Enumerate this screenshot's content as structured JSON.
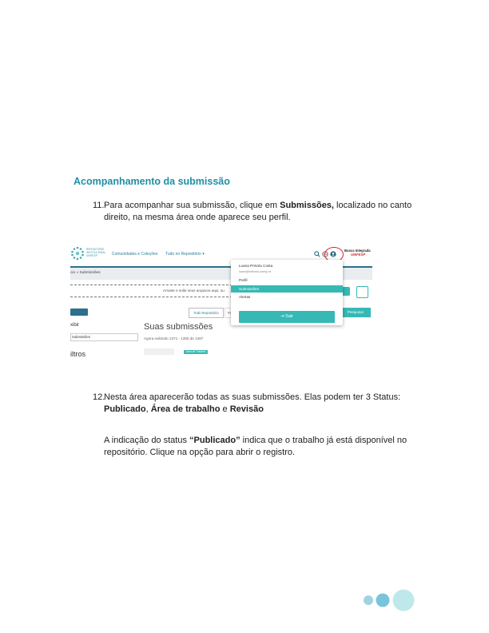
{
  "section_title": "Acompanhamento da submissão",
  "step11": {
    "number": "11.",
    "text_before": "Para acompanhar sua submissão, clique em ",
    "bold": "Submissões,",
    "text_after": " localizado no canto direito, na mesma área onde aparece seu perfil."
  },
  "screenshot": {
    "logo_text": "REPOSITÓRIO INSTITUCIONAL UNIFESP",
    "nav_communities": "Comunidades e Coleções",
    "nav_repository": "Tudo no Repositório ▾",
    "busca_line1": "Busca Integrada",
    "busca_line2": "UNIFESP",
    "breadcrumb": "cio » Submissões",
    "upload_text": "Arraste e solte seus arquivos aqui, ou",
    "tab_all": "Todo Repositório",
    "search_placeholder": "Pesquisar no repositório",
    "search_button": "Pesquisar",
    "exibir_label": "xibir",
    "select_value": "Submissões",
    "filtros_label": "iltros",
    "page_title": "Suas submissões",
    "showing": "Agora exibindo 1371 - 1380 de 1387",
    "badge": "Área de Trabalho",
    "menu": {
      "user_name": "Luana Priscila Costa",
      "user_email": "luana@reitoria.unesp.br",
      "perfil": "Perfil",
      "submissoes": "Submissões",
      "alertas": "Alertas",
      "sair": "Sair"
    }
  },
  "step12": {
    "number": "12.",
    "text": "Nesta área aparecerão todas as suas submissões. Elas podem ter 3 Status:",
    "status1": "Publicado",
    "status2": "Área de trabalho",
    "status3": "Revisão",
    "sep1": ", ",
    "sep2": " e "
  },
  "paragraph": {
    "before": "A indicação do status ",
    "bold": "“Publicado”",
    "after": " indica que o trabalho já está disponível no repositório. Clique na opção para abrir o registro."
  },
  "colors": {
    "accent": "#1f8fa6",
    "teal": "#36b9b5",
    "highlight_ring": "#e0202a"
  }
}
